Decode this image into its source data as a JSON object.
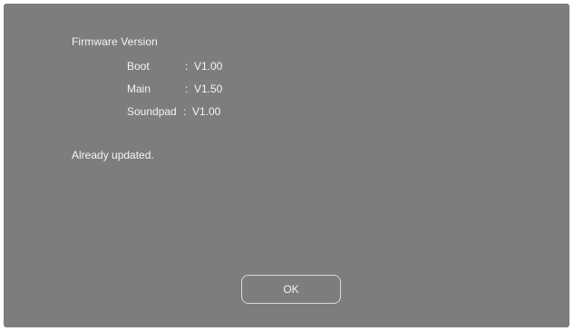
{
  "dialog": {
    "title": "Firmware Version",
    "versions": [
      {
        "name": "Boot",
        "separator": ":",
        "value": "V1.00"
      },
      {
        "name": "Main",
        "separator": ":",
        "value": "V1.50"
      },
      {
        "name": "Soundpad",
        "separator": ":",
        "value": "V1.00"
      }
    ],
    "status": "Already updated.",
    "ok_label": "OK"
  },
  "colors": {
    "dialog_background": "#7d7d7d",
    "text": "#f4f4f4",
    "button_border": "#d8d8d8"
  }
}
